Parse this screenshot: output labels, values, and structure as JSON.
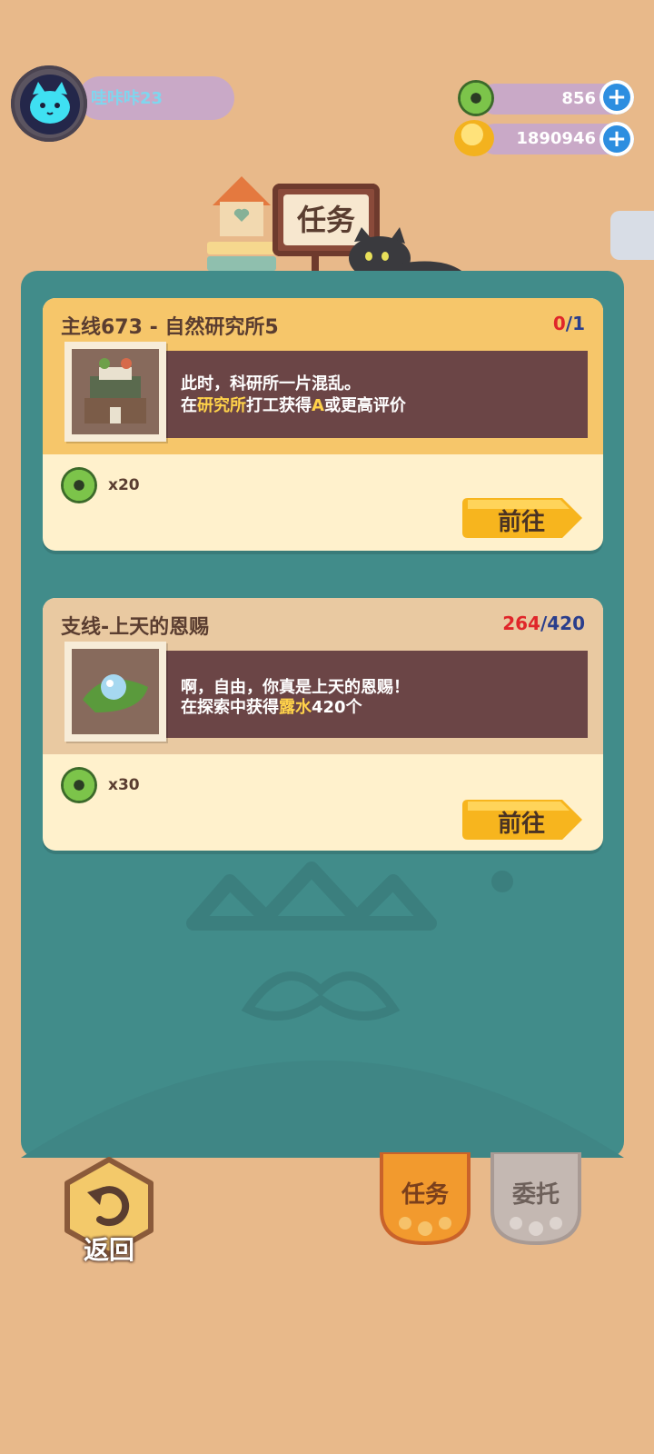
{
  "player": {
    "name": "哇咔咔23"
  },
  "currencies": {
    "gems": "856",
    "coins": "1890946"
  },
  "header": {
    "title": "任务"
  },
  "quests": [
    {
      "title": "主线673 - 自然研究所5",
      "progress_current": "0",
      "progress_total": "/1",
      "desc_line1": "此时，科研所一片混乱。",
      "desc_line2_pre": "在",
      "desc_line2_hl1": "研究所",
      "desc_line2_mid": "打工获得",
      "desc_line2_hl2": "A",
      "desc_line2_post": "或更高评价",
      "reward_qty": "x20",
      "go_label": "前往"
    },
    {
      "title": "支线-上天的恩赐",
      "progress_current": "264",
      "progress_total": "/420",
      "desc_line1": "啊，自由，你真是上天的恩赐！",
      "desc_line2_pre": "在探索中获得",
      "desc_line2_hl1": "露水",
      "desc_line2_post": "420个",
      "reward_qty": "x30",
      "go_label": "前往"
    }
  ],
  "footer": {
    "back_label": "返回",
    "tab_tasks": "任务",
    "tab_commission": "委托"
  },
  "colors": {
    "background": "#e8b98a",
    "panel": "#418c8a",
    "card_head": "#f6c66a",
    "card_head_alt": "#e9c9a1",
    "progress_red": "#e0262a",
    "progress_blue": "#2a3e8c",
    "go_button": "#f7b51e"
  }
}
